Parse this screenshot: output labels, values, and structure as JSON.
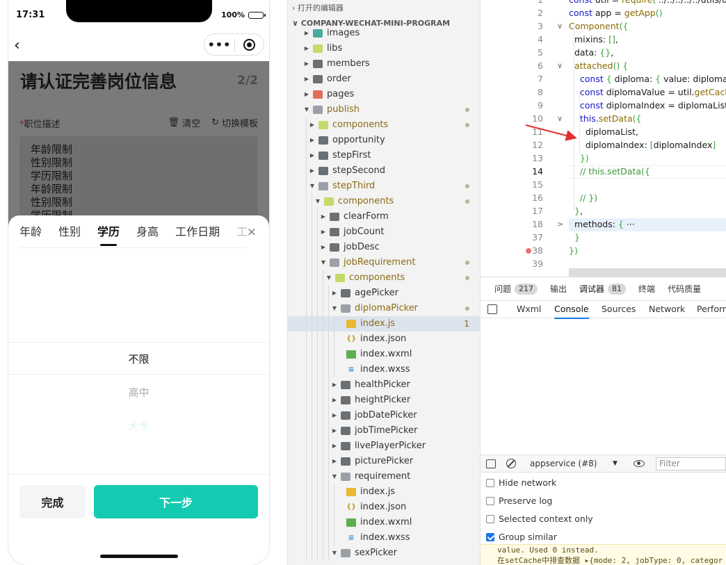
{
  "phone": {
    "status": {
      "time": "17:31",
      "battery": "100%",
      "battery_level": 1.0
    },
    "capsule": {
      "more": "•••"
    },
    "page": {
      "title": "请认证完善岗位信息",
      "step": "2/2",
      "field_required_mark": "*",
      "field_label": "职位描述",
      "clear_label": "清空",
      "switch_label": "切换模板",
      "textarea_lines": [
        "年龄限制",
        "性别限制",
        "学历限制",
        "年龄限制",
        "性别限制",
        "学历限制"
      ]
    },
    "sheet": {
      "tabs": [
        "年龄",
        "性别",
        "学历",
        "身高",
        "工作日期",
        "工"
      ],
      "active_tab": "学历",
      "close": "×",
      "options": [
        "不限",
        "高中",
        "大专"
      ],
      "done_label": "完成",
      "next_label": "下一步"
    },
    "colors": {
      "accent": "#13cbb2",
      "required": "#8b1e1e"
    }
  },
  "explorer": {
    "open_editors": "打开的编辑器",
    "project": "COMPANY-WECHAT-MINI-PROGRAM",
    "rows": [
      {
        "label": "images",
        "depth": 0,
        "type": "folder",
        "icon": "fold-teal",
        "open": false,
        "mod": false
      },
      {
        "label": "libs",
        "depth": 0,
        "type": "folder",
        "icon": "fold-green",
        "open": false,
        "mod": false
      },
      {
        "label": "members",
        "depth": 0,
        "type": "folder",
        "icon": "fold-gray",
        "open": false,
        "mod": false
      },
      {
        "label": "order",
        "depth": 0,
        "type": "folder",
        "icon": "fold-gray",
        "open": false,
        "mod": false
      },
      {
        "label": "pages",
        "depth": 0,
        "type": "folder",
        "icon": "fold-pink",
        "open": false,
        "mod": false
      },
      {
        "label": "publish",
        "depth": 0,
        "type": "folder",
        "icon": "fold-open",
        "open": true,
        "mod": true
      },
      {
        "label": "components",
        "depth": 1,
        "type": "folder",
        "icon": "fold-green",
        "open": false,
        "mod": true
      },
      {
        "label": "opportunity",
        "depth": 1,
        "type": "folder",
        "icon": "fold-gray",
        "open": false,
        "mod": false
      },
      {
        "label": "stepFirst",
        "depth": 1,
        "type": "folder",
        "icon": "fold-gray",
        "open": false,
        "mod": false
      },
      {
        "label": "stepSecond",
        "depth": 1,
        "type": "folder",
        "icon": "fold-gray",
        "open": false,
        "mod": false
      },
      {
        "label": "stepThird",
        "depth": 1,
        "type": "folder",
        "icon": "fold-open",
        "open": true,
        "mod": true
      },
      {
        "label": "components",
        "depth": 2,
        "type": "folder",
        "icon": "fold-green",
        "open": true,
        "mod": true
      },
      {
        "label": "clearForm",
        "depth": 3,
        "type": "folder",
        "icon": "fold-gray",
        "open": false,
        "mod": false
      },
      {
        "label": "jobCount",
        "depth": 3,
        "type": "folder",
        "icon": "fold-gray",
        "open": false,
        "mod": false
      },
      {
        "label": "jobDesc",
        "depth": 3,
        "type": "folder",
        "icon": "fold-gray",
        "open": false,
        "mod": false
      },
      {
        "label": "jobRequirement",
        "depth": 3,
        "type": "folder",
        "icon": "fold-open",
        "open": true,
        "mod": true
      },
      {
        "label": "components",
        "depth": 4,
        "type": "folder",
        "icon": "fold-green",
        "open": true,
        "mod": true
      },
      {
        "label": "agePicker",
        "depth": 5,
        "type": "folder",
        "icon": "fold-gray",
        "open": false,
        "mod": false
      },
      {
        "label": "diplomaPicker",
        "depth": 5,
        "type": "folder",
        "icon": "fold-open",
        "open": true,
        "mod": true
      },
      {
        "label": "index.js",
        "depth": 6,
        "type": "file",
        "icon": "f-js",
        "mod": true,
        "sel": true,
        "count": "1"
      },
      {
        "label": "index.json",
        "depth": 6,
        "type": "file",
        "icon": "f-json",
        "mod": false
      },
      {
        "label": "index.wxml",
        "depth": 6,
        "type": "file",
        "icon": "f-wxml",
        "mod": false
      },
      {
        "label": "index.wxss",
        "depth": 6,
        "type": "file",
        "icon": "f-wxss",
        "mod": false
      },
      {
        "label": "healthPicker",
        "depth": 5,
        "type": "folder",
        "icon": "fold-gray",
        "open": false,
        "mod": false
      },
      {
        "label": "heightPicker",
        "depth": 5,
        "type": "folder",
        "icon": "fold-gray",
        "open": false,
        "mod": false
      },
      {
        "label": "jobDatePicker",
        "depth": 5,
        "type": "folder",
        "icon": "fold-gray",
        "open": false,
        "mod": false
      },
      {
        "label": "jobTimePicker",
        "depth": 5,
        "type": "folder",
        "icon": "fold-gray",
        "open": false,
        "mod": false
      },
      {
        "label": "livePlayerPicker",
        "depth": 5,
        "type": "folder",
        "icon": "fold-gray",
        "open": false,
        "mod": false
      },
      {
        "label": "picturePicker",
        "depth": 5,
        "type": "folder",
        "icon": "fold-gray",
        "open": false,
        "mod": false
      },
      {
        "label": "requirement",
        "depth": 5,
        "type": "folder",
        "icon": "fold-open",
        "open": true,
        "mod": false
      },
      {
        "label": "index.js",
        "depth": 6,
        "type": "file",
        "icon": "f-js",
        "mod": false
      },
      {
        "label": "index.json",
        "depth": 6,
        "type": "file",
        "icon": "f-json",
        "mod": false
      },
      {
        "label": "index.wxml",
        "depth": 6,
        "type": "file",
        "icon": "f-wxml",
        "mod": false
      },
      {
        "label": "index.wxss",
        "depth": 6,
        "type": "file",
        "icon": "f-wxss",
        "mod": false
      },
      {
        "label": "sexPicker",
        "depth": 5,
        "type": "folder",
        "icon": "fold-open",
        "open": true,
        "mod": false
      }
    ]
  },
  "editor": {
    "line_numbers": [
      "1",
      "2",
      "3",
      "4",
      "5",
      "6",
      "7",
      "8",
      "9",
      "10",
      "11",
      "12",
      "13",
      "14",
      "15",
      "16",
      "17",
      "18",
      "37",
      "38",
      "39"
    ],
    "current_line": "14",
    "fold_markers": {
      "3": "∨",
      "6": "∨",
      "10": "∨",
      "18": ">"
    },
    "lines": [
      "const util = require('../../../../../utils/util')",
      "const app = getApp()",
      "Component({",
      "  mixins: [],",
      "  data: {},",
      "  attached() {",
      "    const { diploma: { value: diplomaList",
      "    const diplomaValue = util.getCache('",
      "    const diplomaIndex = diplomaList.find",
      "    this.setData({",
      "      diplomaList,",
      "      diplomaIndex: [diplomaIndex]",
      "    })",
      "    // this.setData({",
      "",
      "    // })",
      "  },",
      "  methods: { ···",
      "  }",
      "})",
      ""
    ]
  },
  "panel": {
    "tabs": [
      {
        "label": "问题",
        "badge": "217"
      },
      {
        "label": "输出",
        "badge": ""
      },
      {
        "label": "调试器",
        "badge": "81"
      },
      {
        "label": "终端",
        "badge": ""
      },
      {
        "label": "代码质量",
        "badge": ""
      }
    ],
    "devtools_tabs": [
      "Wxml",
      "Console",
      "Sources",
      "Network",
      "Perform"
    ],
    "active_devtools_tab": "Console",
    "context": "appservice (#8)",
    "filter_placeholder": "Filter",
    "options": [
      {
        "label": "Hide network",
        "checked": false
      },
      {
        "label": "Preserve log",
        "checked": false
      },
      {
        "label": "Selected context only",
        "checked": false
      },
      {
        "label": "Group similar",
        "checked": true
      }
    ],
    "log": [
      "value. Used 0 instead.",
      "在setCache中排查数据 ▸{mode: 2, jobType: 0, categor"
    ]
  },
  "annotation": {
    "color": "#e03131"
  }
}
